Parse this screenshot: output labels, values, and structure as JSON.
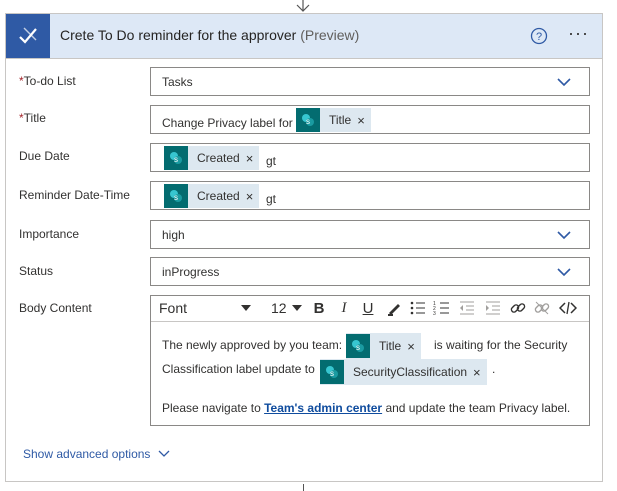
{
  "header": {
    "title": "Crete To Do reminder for the approver",
    "preview": "(Preview)",
    "more": "···"
  },
  "fields": {
    "todo_list": {
      "label": "To-do List",
      "value": "Tasks"
    },
    "title": {
      "label": "Title",
      "prefix": "Change Privacy label for",
      "token": "Title"
    },
    "due_date": {
      "label": "Due Date",
      "token": "Created",
      "suffix": "gt"
    },
    "reminder": {
      "label": "Reminder Date-Time",
      "token": "Created",
      "suffix": "gt"
    },
    "importance": {
      "label": "Importance",
      "value": "high"
    },
    "status": {
      "label": "Status",
      "value": "inProgress"
    },
    "body": {
      "label": "Body Content",
      "font": "Font",
      "size": "12",
      "line1_prefix": "The newly approved by you team:",
      "line1_token": "Title",
      "line1_suffix": "is waiting for the Security",
      "line2_prefix": "Classification label update to",
      "line2_token": "SecurityClassification",
      "line2_suffix": ".",
      "line3_prefix": "Please navigate to",
      "line3_link": "Team's admin center",
      "line3_suffix": "and update the team Privacy label."
    }
  },
  "required_mark": "*",
  "token_close": "×",
  "advanced_label": "Show advanced options",
  "colors": {
    "header_bg": "#dde8f6",
    "icon_bg": "#2f5aa5",
    "token_icon_bg": "#036c70",
    "link": "#0f4c9e"
  }
}
